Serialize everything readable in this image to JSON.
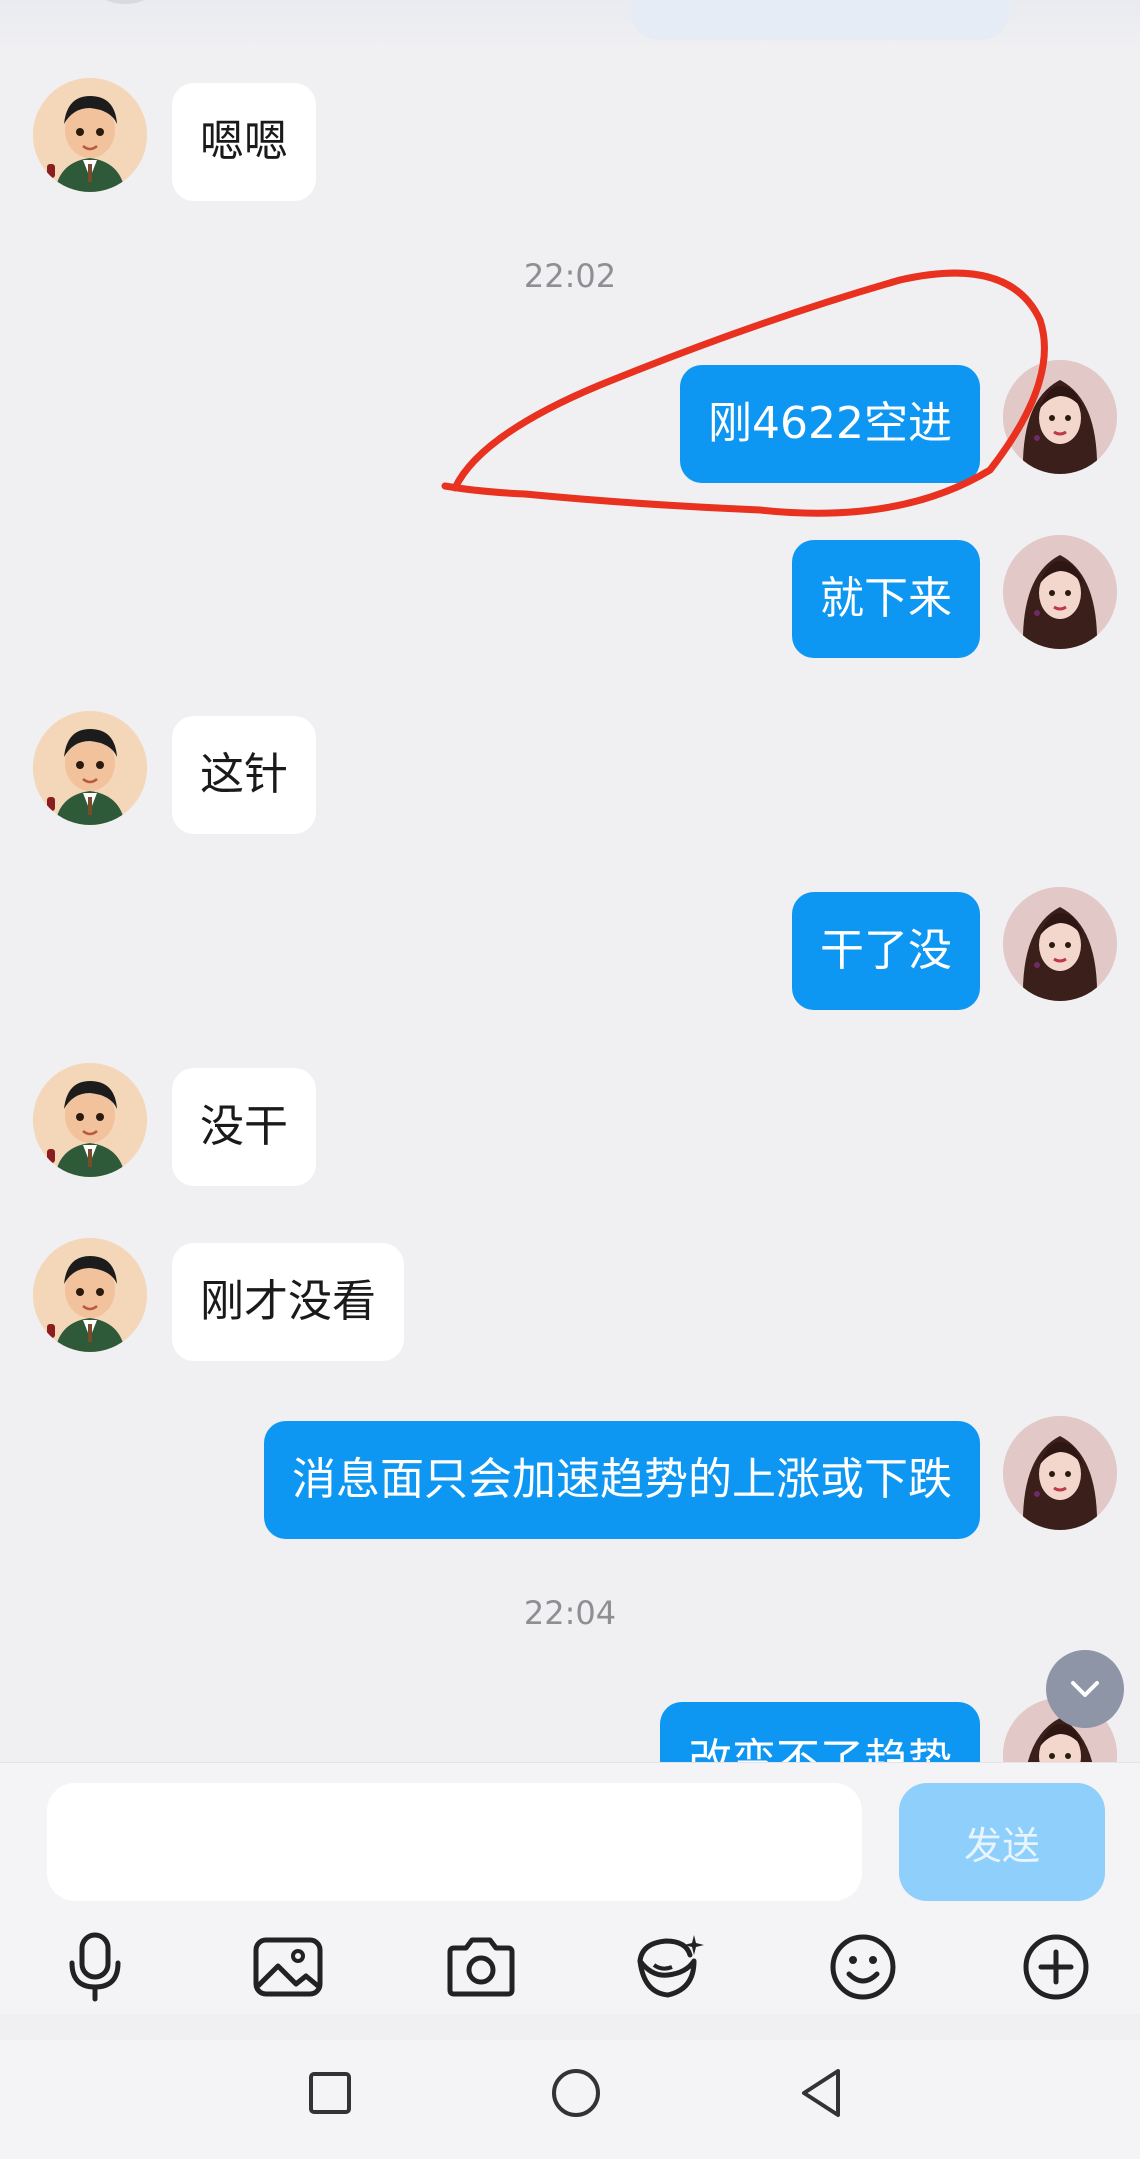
{
  "messages": [
    {
      "side": "in",
      "text": "嗯嗯"
    },
    {
      "time": "22:02"
    },
    {
      "side": "out",
      "text": "刚4622空进"
    },
    {
      "side": "out",
      "text": "就下来"
    },
    {
      "side": "in",
      "text": "这针"
    },
    {
      "side": "out",
      "text": "干了没"
    },
    {
      "side": "in",
      "text": "没干"
    },
    {
      "side": "in",
      "text": "刚才没看"
    },
    {
      "side": "out",
      "text": "消息面只会加速趋势的上涨或下跌"
    },
    {
      "time": "22:04"
    },
    {
      "side": "out",
      "text": "改变不了趋势"
    }
  ],
  "composer": {
    "placeholder": "",
    "send_label": "发送"
  },
  "toolbar_icons": [
    "microphone-icon",
    "image-icon",
    "camera-icon",
    "sticker-icon",
    "emoji-icon",
    "plus-icon"
  ],
  "nav_icons": [
    "square-icon",
    "circle-icon",
    "back-triangle-icon"
  ],
  "colors": {
    "outgoing": "#0d97f2",
    "incoming": "#ffffff",
    "annotation": "#e8321f",
    "send_disabled": "#8fcffb"
  }
}
